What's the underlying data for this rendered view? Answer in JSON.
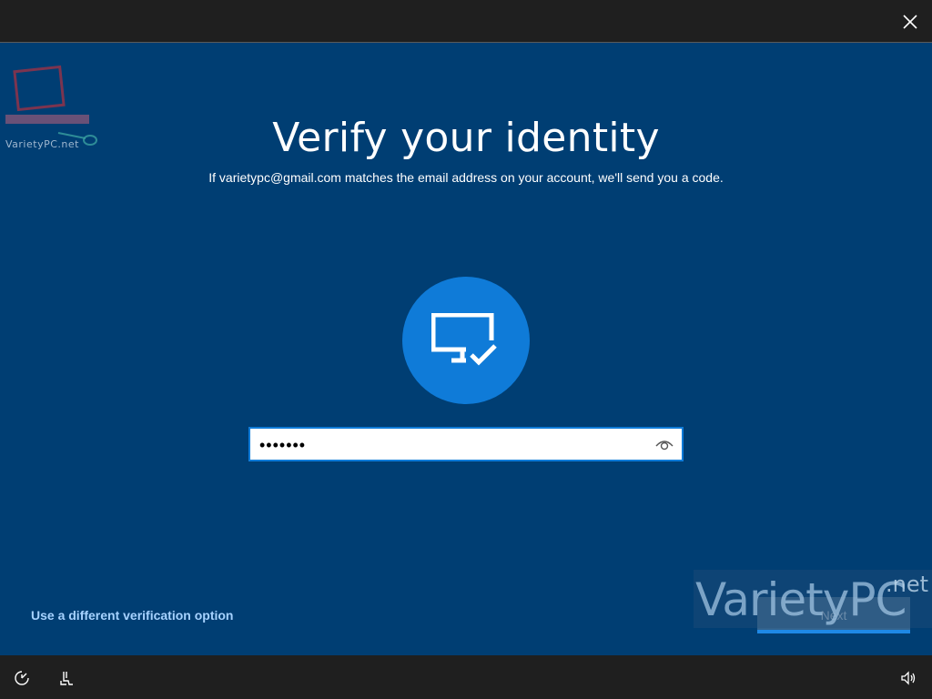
{
  "title": "Verify your identity",
  "subtitle": "If varietypc@gmail.com matches the email address on your account, we'll send you a code.",
  "password_field": {
    "value": "•••••••"
  },
  "alt_option_link": "Use a different verification option",
  "next_button_label": "Next",
  "watermark": {
    "top_left": "VarietyPC.net",
    "bottom_right_main": "VarietyPC",
    "bottom_right_suffix": ".net"
  },
  "icons": {
    "close": "close-icon",
    "hero": "monitor-check-icon",
    "reveal": "eye-icon",
    "ease_of_access": "ease-of-access-icon",
    "accessibility_keyboard": "accessibility-icon",
    "volume": "volume-icon"
  },
  "colors": {
    "background": "#003e73",
    "accent": "#0f7bd8",
    "link": "#a6d2ff",
    "bars": "#1f1f1f"
  }
}
